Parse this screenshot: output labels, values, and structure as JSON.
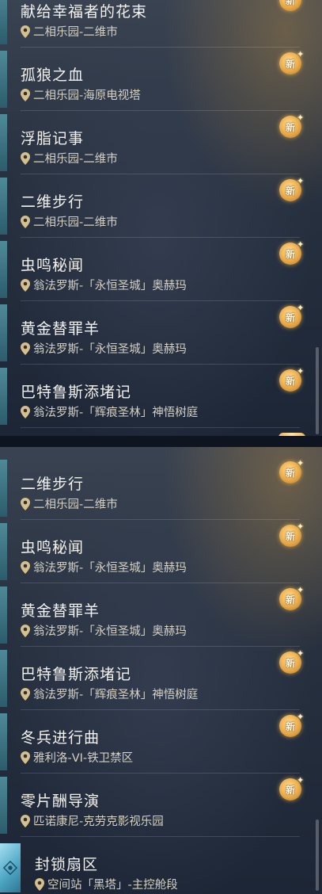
{
  "new_badge_label": "新",
  "colors": {
    "accent_bar": "#4f8a98",
    "badge_gold": "#f0b453",
    "title_text": "#f3f1ec",
    "location_text": "#d6d0c0"
  },
  "icons": {
    "location": "map-pin-icon",
    "new": "new-badge-icon",
    "quest": "quest-hex-icon"
  },
  "top_list": [
    {
      "title": "献给幸福者的花束",
      "location": "二相乐园-二维市"
    },
    {
      "title": "孤狼之血",
      "location": "二相乐园-海原电视塔"
    },
    {
      "title": "浮脂记事",
      "location": "二相乐园-二维市"
    },
    {
      "title": "二维步行",
      "location": "二相乐园-二维市"
    },
    {
      "title": "虫鸣秘闻",
      "location": "翁法罗斯-「永恒圣城」奥赫玛"
    },
    {
      "title": "黄金替罪羊",
      "location": "翁法罗斯-「永恒圣城」奥赫玛"
    },
    {
      "title": "巴特鲁斯添堵记",
      "location": "翁法罗斯-「辉痕圣林」神悟树庭"
    }
  ],
  "bottom_list": [
    {
      "title": "二维步行",
      "location": "二相乐园-二维市"
    },
    {
      "title": "虫鸣秘闻",
      "location": "翁法罗斯-「永恒圣城」奥赫玛"
    },
    {
      "title": "黄金替罪羊",
      "location": "翁法罗斯-「永恒圣城」奥赫玛"
    },
    {
      "title": "巴特鲁斯添堵记",
      "location": "翁法罗斯-「辉痕圣林」神悟树庭"
    },
    {
      "title": "冬兵进行曲",
      "location": "雅利洛-VI-铁卫禁区"
    },
    {
      "title": "零片酬导演",
      "location": "匹诺康尼-克劳克影视乐园"
    },
    {
      "title": "封锁扇区",
      "location": "空间站「黑塔」-主控舱段"
    }
  ]
}
